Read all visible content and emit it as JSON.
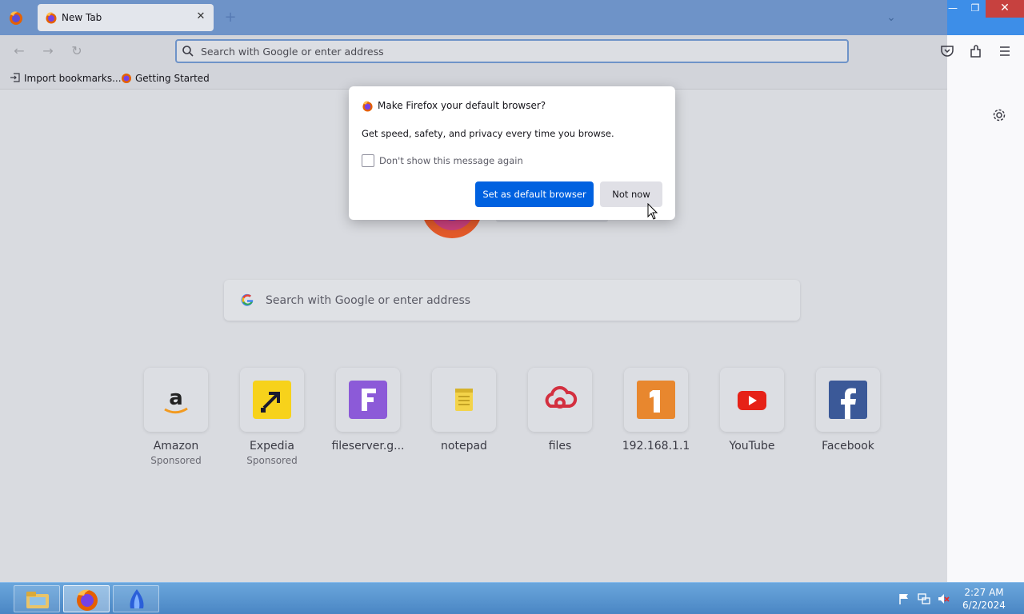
{
  "window": {
    "tab_title": "New Tab",
    "tab_close": "✕",
    "new_tab": "+",
    "tab_list": "⌄",
    "minimize": "—",
    "maximize": "❐",
    "close": "✕"
  },
  "toolbar": {
    "back": "←",
    "forward": "→",
    "reload": "↻",
    "url_placeholder": "Search with Google or enter address",
    "icons": [
      "pocket-icon",
      "extensions-icon",
      "menu-icon"
    ]
  },
  "bookmarks": [
    {
      "label": "Import bookmarks..."
    },
    {
      "label": "Getting Started"
    }
  ],
  "newtab": {
    "search_placeholder": "Search with Google or enter address",
    "tiles": [
      {
        "label": "Amazon",
        "sponsored": "Sponsored",
        "icon": "amazon-icon"
      },
      {
        "label": "Expedia",
        "sponsored": "Sponsored",
        "icon": "expedia-icon"
      },
      {
        "label": "fileserver.g...",
        "sponsored": "",
        "icon": "fileserver-icon"
      },
      {
        "label": "notepad",
        "sponsored": "",
        "icon": "notepad-icon"
      },
      {
        "label": "files",
        "sponsored": "",
        "icon": "files-icon"
      },
      {
        "label": "192.168.1.1",
        "sponsored": "",
        "icon": "router-icon"
      },
      {
        "label": "YouTube",
        "sponsored": "",
        "icon": "youtube-icon"
      },
      {
        "label": "Facebook",
        "sponsored": "",
        "icon": "facebook-icon"
      }
    ]
  },
  "dialog": {
    "title": "Make Firefox your default browser?",
    "body": "Get speed, safety, and privacy every time you browse.",
    "checkbox_label": "Don't show this message again",
    "checkbox_checked": false,
    "primary_button": "Set as default browser",
    "secondary_button": "Not now"
  },
  "taskbar": {
    "apps": [
      "file-explorer-icon",
      "firefox-icon",
      "app-icon"
    ],
    "active_app": "firefox-icon",
    "time": "2:27 AM",
    "date": "6/2/2024"
  },
  "colors": {
    "accent": "#0061e0",
    "titlebar": "#6e93c8",
    "close": "#c7413f"
  }
}
